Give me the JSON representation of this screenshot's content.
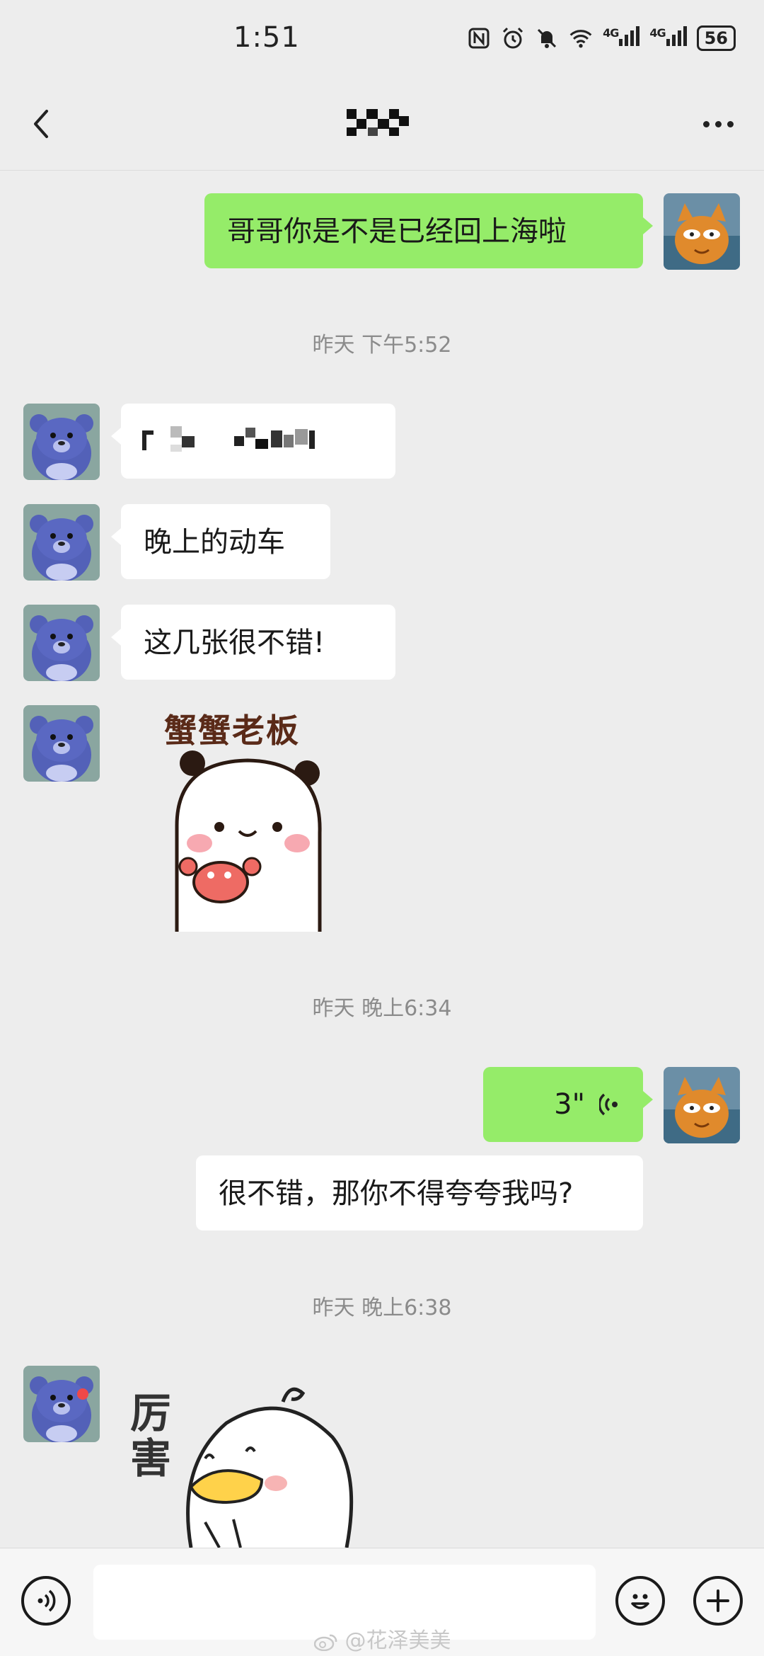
{
  "status_bar": {
    "time": "1:51",
    "network_1": "4G",
    "network_2": "4G",
    "battery": "56",
    "icons": [
      "nfc-icon",
      "alarm-icon",
      "mute-icon",
      "wifi-icon",
      "signal-icon",
      "signal-icon",
      "battery-icon"
    ]
  },
  "header": {
    "back_icon": "chevron-left-icon",
    "title_obscured": true,
    "more_icon": "more-dots-icon"
  },
  "messages": {
    "m1": "哥哥你是不是已经回上海啦",
    "ts1": "昨天 下午5:52",
    "m2_obscured": true,
    "m3": "晚上的动车",
    "m4": "这几张很不错!",
    "sticker1_text": "蟹蟹老板",
    "ts2": "昨天 晚上6:34",
    "voice_duration": "3\"",
    "m6": "很不错，那你不得夸夸我吗?",
    "ts3": "昨天 晚上6:38",
    "sticker2_text": "厉害"
  },
  "input_bar": {
    "voice_icon": "voice-toggle-icon",
    "emoji_icon": "emoji-icon",
    "plus_icon": "plus-icon",
    "placeholder": ""
  },
  "watermark": "@花泽美美",
  "colors": {
    "background": "#ededed",
    "sent_bubble": "#95ec69",
    "received_bubble": "#ffffff",
    "timestamp": "#8b8b8b"
  }
}
